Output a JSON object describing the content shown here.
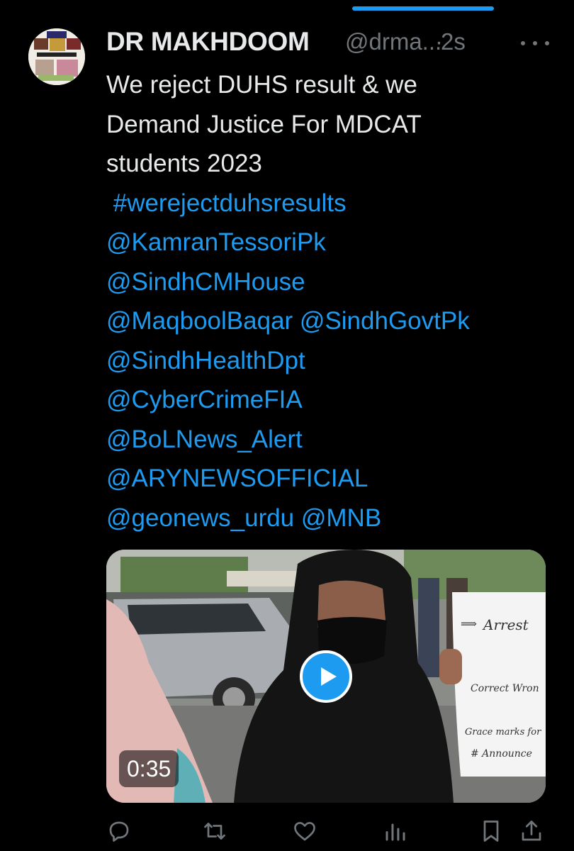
{
  "tweet": {
    "author": {
      "display_name": "DR MAKHDOOM",
      "handle": "@drma...",
      "separator": "·",
      "timestamp": "2s"
    },
    "text_lines": [
      {
        "text": "We reject DUHS result & we",
        "link": false
      },
      {
        "text": "Demand Justice For MDCAT",
        "link": false
      },
      {
        "text": "students 2023",
        "link": false
      },
      {
        "text": " #werejectduhsresults",
        "link": true
      },
      {
        "text": "@KamranTessoriPk",
        "link": true
      },
      {
        "text": "@SindhCMHouse",
        "link": true
      },
      {
        "text": "@MaqboolBaqar @SindhGovtPk",
        "link": true
      },
      {
        "text": "@SindhHealthDpt",
        "link": true
      },
      {
        "text": "@CyberCrimeFIA",
        "link": true
      },
      {
        "text": "@BoLNews_Alert",
        "link": true
      },
      {
        "text": "@ARYNEWSOFFICIAL",
        "link": true
      },
      {
        "text": "@geonews_urdu @MNB",
        "link": true
      }
    ],
    "media": {
      "type": "video",
      "duration": "0:35",
      "sign_lines": [
        "Arrest",
        "Correct Wron",
        "Grace marks for",
        "# Announce"
      ],
      "sign_arrow": "⟹"
    },
    "actions": [
      {
        "name": "reply-icon"
      },
      {
        "name": "retweet-icon"
      },
      {
        "name": "like-icon"
      },
      {
        "name": "views-icon"
      },
      {
        "name": "bookmark-icon"
      },
      {
        "name": "share-icon"
      }
    ]
  },
  "colors": {
    "background": "#000000",
    "text_primary": "#e7e9ea",
    "text_secondary": "#71767b",
    "accent": "#1d9bf0"
  }
}
